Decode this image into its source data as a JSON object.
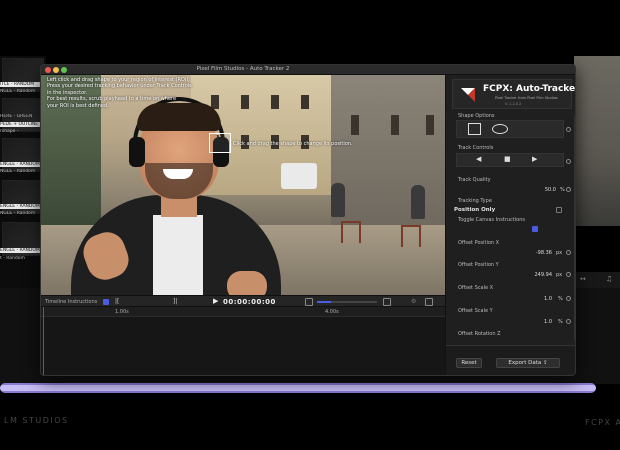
{
  "window": {
    "title": "Pixel Film Studios - Auto Tracker 2"
  },
  "background": {
    "left_tags": [
      "ITLE - RANDOM",
      "NGLE - Random",
      "HERE - GREEN",
      "PEDE + OUTLINE",
      "rshape -",
      "ENGLE - RANDOM",
      "NGLE - Random",
      "ENGLE - RANDOM",
      "NGLE - Random",
      "ENGLE - RANDOM",
      "t - Random"
    ],
    "brand_left": "LM STUDIOS",
    "brand_right": "FCPX A"
  },
  "viewer": {
    "instructions": [
      "Left click and drag shape to your region of interest (ROI).",
      "Press your desired tracking behavior under Track Controls",
      "in the inspector.",
      "For best results, scrub playhead to a time on where",
      "your ROI is best defined."
    ],
    "roi_tip": "Click and drag the shape to change its position."
  },
  "transport": {
    "label": "Timeline Instructions",
    "timecode": "00:00:00:00",
    "play_icon": "▶"
  },
  "ruler": {
    "marks": [
      "1.00s",
      "4.00s"
    ]
  },
  "panel": {
    "logo_title": "FCPX: Auto-Tracker",
    "logo_sub": "Pixel Tracker from Pixel Film Studios",
    "logo_ver": "V. 1.2.0.2",
    "shape_options": "Shape Options",
    "track_controls": "Track Controls",
    "controls": {
      "back": "◀",
      "stop": "■",
      "forward": "▶"
    },
    "track_quality": "Track Quality",
    "track_quality_value": "50.0",
    "track_quality_unit": "%",
    "tracking_type": "Tracking Type",
    "tracking_type_value": "Position Only",
    "toggle_canvas": "Toggle Canvas Instructions",
    "offset_x": "Offset Position X",
    "offset_x_value": "-98.36",
    "offset_x_unit": "px",
    "offset_y": "Offset Position Y",
    "offset_y_value": "249.94",
    "offset_y_unit": "px",
    "scale_x": "Offset Scale X",
    "scale_x_value": "1.0",
    "scale_x_unit": "%",
    "scale_y": "Offset Scale Y",
    "scale_y_value": "1.0",
    "scale_y_unit": "%",
    "rotation": "Offset Rotation Z",
    "reset_label": "Reset",
    "export_label": "Export Data"
  },
  "colors": {
    "accent": "#4a5de0",
    "purple_bar": "#8a7ad0",
    "playhead": "#c0392b"
  }
}
